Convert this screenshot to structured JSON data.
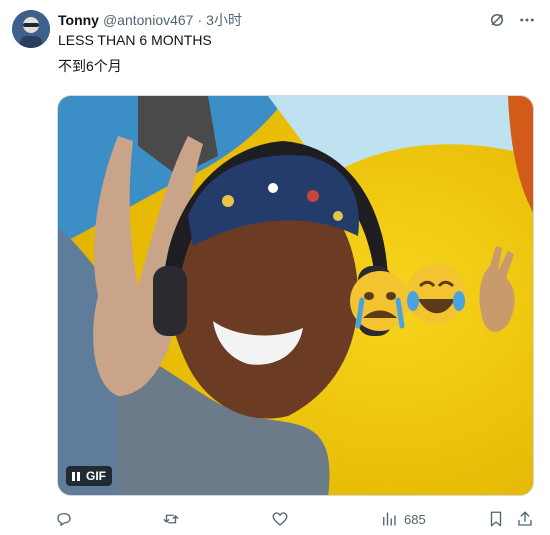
{
  "author": {
    "display_name": "Tonny",
    "handle": "@antoniov467",
    "separator": "·",
    "timestamp": "3小时"
  },
  "post": {
    "text_line1": "LESS THAN 6 MONTHS",
    "text_line2": "不到6个月"
  },
  "media": {
    "badge_label": "GIF",
    "emojis": [
      "crying-face",
      "tears-of-joy-face",
      "victory-hand"
    ]
  },
  "actions": {
    "views_count": "685"
  },
  "colors": {
    "text_primary": "#0f1419",
    "text_secondary": "#536471",
    "gif_background": "#f1cc0c"
  }
}
